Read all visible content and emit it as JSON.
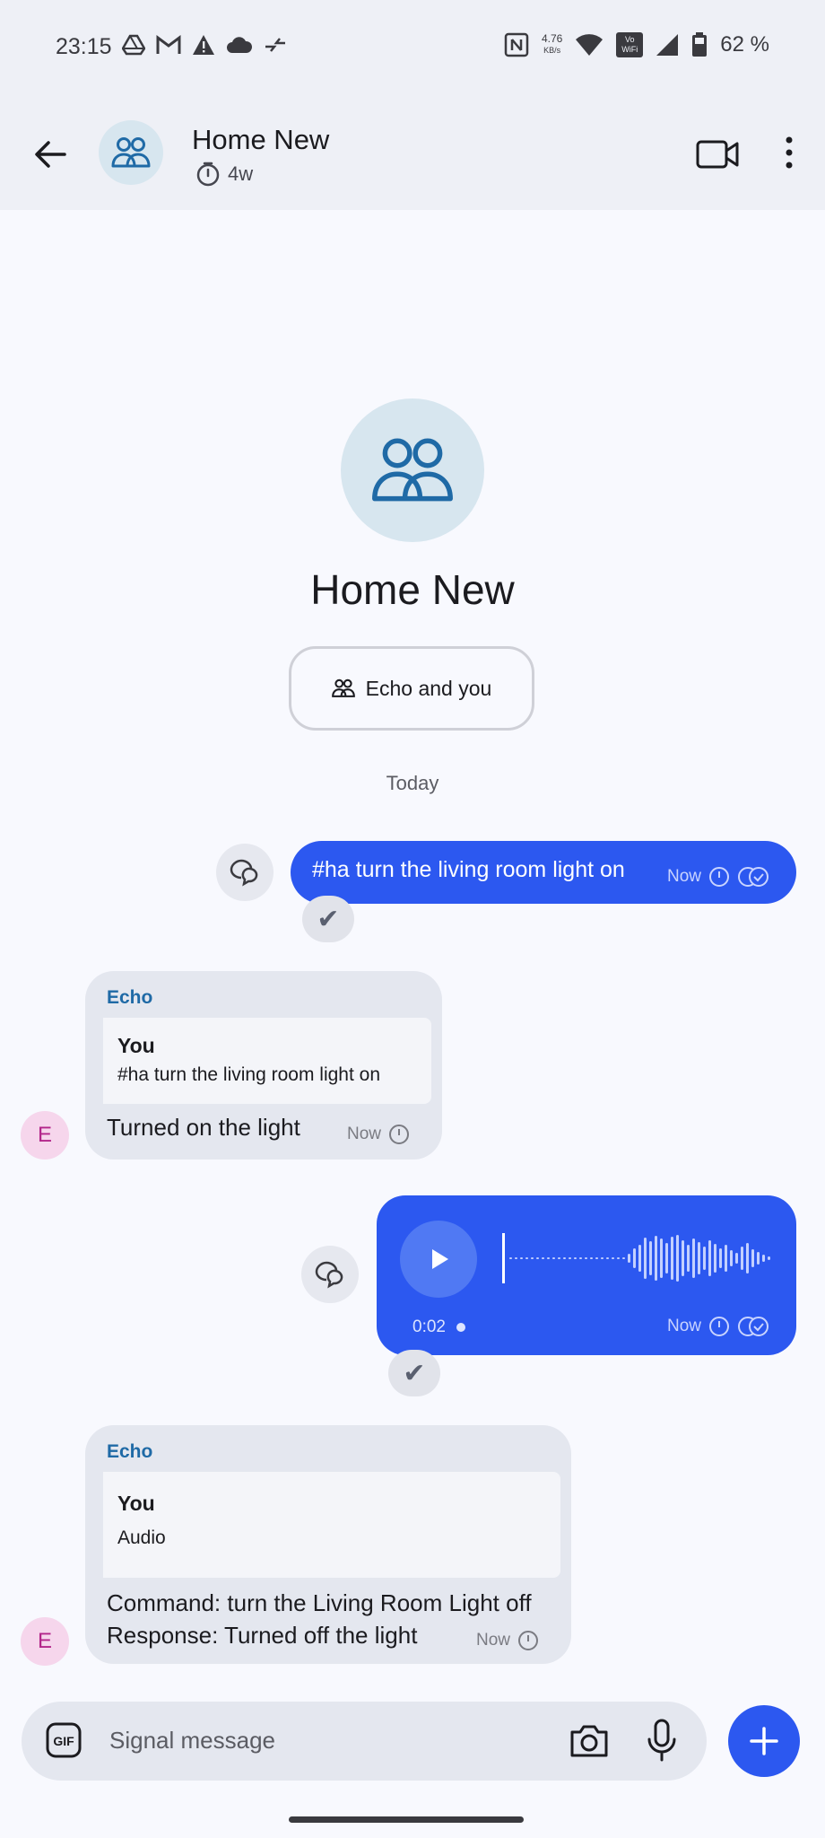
{
  "status_bar": {
    "time": "23:15",
    "speed_value": "4.76",
    "speed_unit": "KB/s",
    "wifi_label_top": "Vo",
    "wifi_label_bottom": "WiFi",
    "battery": "62 %"
  },
  "app_bar": {
    "title": "Home New",
    "timer_label": "4w"
  },
  "header": {
    "group_name": "Home New",
    "members_label": "Echo and you"
  },
  "date_separator": "Today",
  "messages": [
    {
      "direction": "out",
      "text": "#ha turn the living room light on",
      "time": "Now"
    },
    {
      "direction": "in",
      "sender": "Echo",
      "quote_author": "You",
      "quote_text": "#ha turn the living room light on",
      "text": "Turned on the light",
      "time": "Now",
      "avatar_letter": "E"
    },
    {
      "direction": "out",
      "type": "audio",
      "duration": "0:02",
      "time": "Now"
    },
    {
      "direction": "in",
      "sender": "Echo",
      "quote_author": "You",
      "quote_text": "Audio",
      "text_line1": "Command: turn the Living Room Light off",
      "text_line2": "Response: Turned off the light",
      "time": "Now",
      "avatar_letter": "E"
    }
  ],
  "composer": {
    "placeholder": "Signal message"
  },
  "colors": {
    "accent": "#2c58f0",
    "incoming_bubble": "#e4e7ef",
    "sender_name": "#1f6aa6",
    "avatar_bg": "#d7e6ef"
  }
}
